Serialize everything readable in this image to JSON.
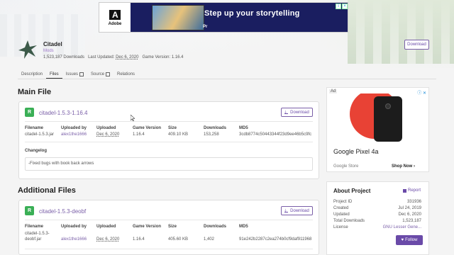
{
  "top_ad": {
    "brand": "Adobe",
    "headline": "Step up your storytelling",
    "badge": "Pr"
  },
  "project": {
    "title": "Citadel",
    "category": "Mods",
    "downloads": "1,523,187 Downloads",
    "last_updated_label": "Last Updated:",
    "last_updated": "Dec 6, 2020",
    "game_version_label": "Game Version:",
    "game_version": "1.16.4",
    "download_label": "Download"
  },
  "tabs": [
    {
      "label": "Description"
    },
    {
      "label": "Files"
    },
    {
      "label": "Issues"
    },
    {
      "label": "Source"
    },
    {
      "label": "Relations"
    }
  ],
  "main_file": {
    "heading": "Main File",
    "release_badge": "R",
    "file_title": "citadel-1.5.3-1.16.4",
    "download_label": "Download",
    "columns": [
      "Filename",
      "Uploaded by",
      "Uploaded",
      "Game Version",
      "Size",
      "Downloads",
      "MD5"
    ],
    "values": [
      "citadel-1.5.3.jar",
      "alex1the1666",
      "Dec 6, 2020",
      "1.16.4",
      "409.10 KB",
      "153,258",
      "3cdb8774c50443344f23d9ee46b5c9fc"
    ],
    "changelog_label": "Changelog",
    "changelog": "-Fixed bugs with book back arrows"
  },
  "additional_files": {
    "heading": "Additional Files",
    "release_badge": "R",
    "file_title": "citadel-1.5.3-deobf",
    "download_label": "Download",
    "columns": [
      "Filename",
      "Uploaded by",
      "Uploaded",
      "Game Version",
      "Size",
      "Downloads",
      "MD5"
    ],
    "values": [
      "citadel-1.5.3-deobf.jar",
      "alex1the1666",
      "Dec 6, 2020",
      "1.16.4",
      "405.60 KB",
      "1,402",
      "91e242b2287c2ea274b0cf9daf911968"
    ]
  },
  "side_ad": {
    "label": "Ad",
    "product": "Google Pixel 4a",
    "store": "Google Store",
    "cta": "Shop Now"
  },
  "about": {
    "heading": "About Project",
    "report": "Report",
    "rows": [
      {
        "k": "Project ID",
        "v": "331936"
      },
      {
        "k": "Created",
        "v": "Jul 24, 2019"
      },
      {
        "k": "Updated",
        "v": "Dec 6, 2020"
      },
      {
        "k": "Total Downloads",
        "v": "1,523,187"
      },
      {
        "k": "License",
        "v": "GNU Lesser Gene..."
      }
    ],
    "follow": "Follow"
  },
  "colors": {
    "accent": "#6a4aa8",
    "release_green": "#3aaf56",
    "ad_navy": "#1a1e60"
  }
}
